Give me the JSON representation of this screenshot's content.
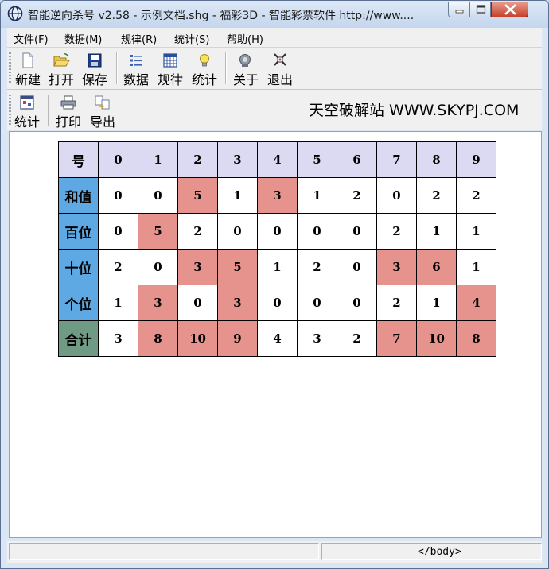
{
  "window": {
    "title": "智能逆向杀号 v2.58 - 示例文档.shg - 福彩3D - 智能彩票软件 http://www...."
  },
  "menu": [
    "文件(F)",
    "数据(M)",
    "规律(R)",
    "统计(S)",
    "帮助(H)"
  ],
  "toolbar1": {
    "new": "新建",
    "open": "打开",
    "save": "保存",
    "data": "数据",
    "rules": "规律",
    "stats": "统计",
    "about": "关于",
    "exit": "退出"
  },
  "toolbar2": {
    "stats": "统计",
    "print": "打印",
    "export": "导出",
    "site": "天空破解站 WWW.SKYPJ.COM"
  },
  "table": {
    "header_label": "号",
    "digits": [
      "0",
      "1",
      "2",
      "3",
      "4",
      "5",
      "6",
      "7",
      "8",
      "9"
    ],
    "rows": [
      {
        "label": "和值",
        "cells": [
          [
            "0",
            false
          ],
          [
            "0",
            false
          ],
          [
            "5",
            true
          ],
          [
            "1",
            false
          ],
          [
            "3",
            true
          ],
          [
            "1",
            false
          ],
          [
            "2",
            false
          ],
          [
            "0",
            false
          ],
          [
            "2",
            false
          ],
          [
            "2",
            false
          ]
        ]
      },
      {
        "label": "百位",
        "cells": [
          [
            "0",
            false
          ],
          [
            "5",
            true
          ],
          [
            "2",
            false
          ],
          [
            "0",
            false
          ],
          [
            "0",
            false
          ],
          [
            "0",
            false
          ],
          [
            "0",
            false
          ],
          [
            "2",
            false
          ],
          [
            "1",
            false
          ],
          [
            "1",
            false
          ]
        ]
      },
      {
        "label": "十位",
        "cells": [
          [
            "2",
            false
          ],
          [
            "0",
            false
          ],
          [
            "3",
            true
          ],
          [
            "5",
            true
          ],
          [
            "1",
            false
          ],
          [
            "2",
            false
          ],
          [
            "0",
            false
          ],
          [
            "3",
            true
          ],
          [
            "6",
            true
          ],
          [
            "1",
            false
          ]
        ]
      },
      {
        "label": "个位",
        "cells": [
          [
            "1",
            false
          ],
          [
            "3",
            true
          ],
          [
            "0",
            false
          ],
          [
            "3",
            true
          ],
          [
            "0",
            false
          ],
          [
            "0",
            false
          ],
          [
            "0",
            false
          ],
          [
            "2",
            false
          ],
          [
            "1",
            false
          ],
          [
            "4",
            true
          ]
        ]
      },
      {
        "label": "合计",
        "cells": [
          [
            "3",
            false
          ],
          [
            "8",
            true
          ],
          [
            "10",
            true
          ],
          [
            "9",
            true
          ],
          [
            "4",
            false
          ],
          [
            "3",
            false
          ],
          [
            "2",
            false
          ],
          [
            "7",
            true
          ],
          [
            "10",
            true
          ],
          [
            "8",
            true
          ]
        ]
      }
    ]
  },
  "status": {
    "pane1": "",
    "pane2": "</body>"
  },
  "colors": {
    "highlight": "#e6938e",
    "header": "#dcdaf2",
    "row_label": "#5ea9e3",
    "total_label": "#6f9a83"
  }
}
